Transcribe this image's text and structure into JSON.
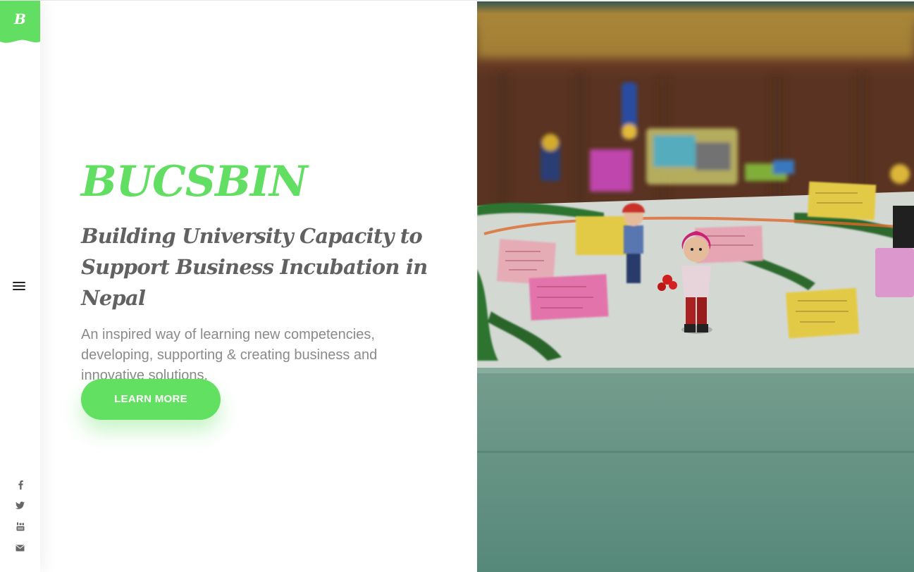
{
  "logo": {
    "letter": "B"
  },
  "hero": {
    "brand": "BUCSBIN",
    "tagline_line1": "Building University Capacity to",
    "tagline_line2": "Support Business Incubation in Nepal",
    "description": "An inspired way of learning new competencies, developing, supporting & creating business and innovative solutions.",
    "cta_label": "LEARN MORE"
  },
  "menu": {
    "icon": "hamburger-icon"
  },
  "social": [
    {
      "name": "facebook-icon"
    },
    {
      "name": "twitter-icon"
    },
    {
      "name": "youtube-icon"
    },
    {
      "name": "email-icon"
    }
  ],
  "colors": {
    "accent": "#62de62",
    "heading": "#616161",
    "body_text": "#8a8a8a",
    "photo_tint": "#5a8f80"
  }
}
